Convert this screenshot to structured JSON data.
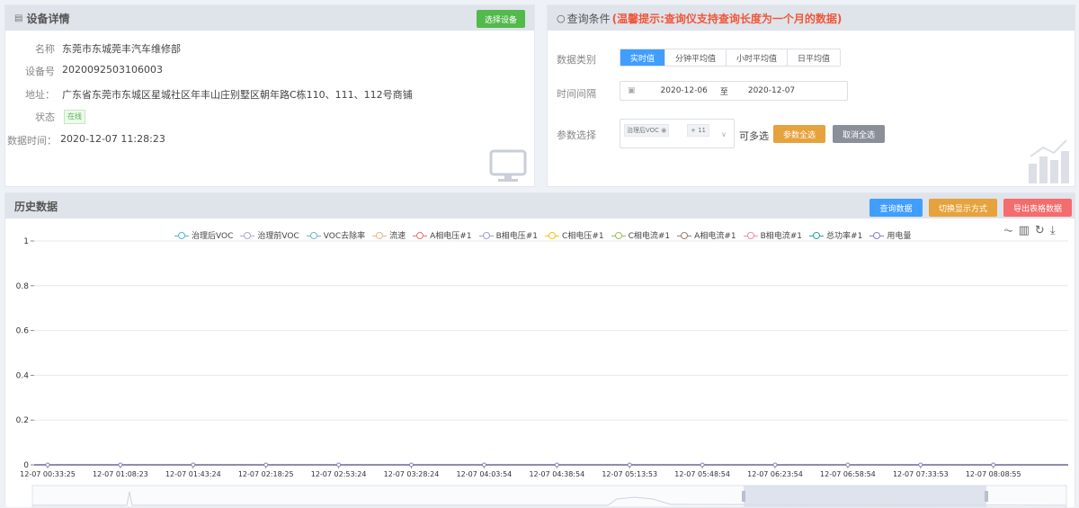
{
  "device": {
    "title": "设备详情",
    "select_button": "选择设备",
    "rows": [
      {
        "label": "名称",
        "value": "东莞市东城莞丰汽车维修部"
      },
      {
        "label": "设备号",
        "value": "2020092503106003"
      },
      {
        "label": "地址：",
        "value": "广东省东莞市东城区星城社区年丰山庄别墅区朝年路C栋110、111、112号商铺"
      },
      {
        "label": "状态",
        "value": "在线"
      },
      {
        "label": "数据时间：",
        "value": "2020-12-07 11:28:23"
      }
    ]
  },
  "query": {
    "title": "查询条件",
    "hint": "(温馨提示:查询仪支持查询长度为一个月的数据)",
    "type_label": "数据类别",
    "types": [
      "实时值",
      "分钟平均值",
      "小时平均值",
      "日平均值"
    ],
    "active_type": "实时值",
    "time_label": "时间间隔",
    "start_date": "2020-12-06",
    "range_sep": "至",
    "end_date": "2020-12-07",
    "param_label": "参数选择",
    "param_tag": "治理后VOC",
    "param_more": "+ 11",
    "multi_text": "可多选",
    "select_all": "参数全选",
    "cancel_all": "取消全选"
  },
  "history": {
    "title": "历史数据",
    "btn_query": "查询数据",
    "btn_switch": "切换显示方式",
    "btn_export": "导出表格数据"
  },
  "colors": {
    "green": "#52b94b",
    "blue": "#409eff",
    "orange": "#e6a23c",
    "gray": "#8a8f99",
    "red": "#f56c6c",
    "line": "#8e7cc3"
  },
  "chart_data": {
    "type": "line",
    "ylim": [
      0,
      1
    ],
    "yticks": [
      "0",
      "0.2",
      "0.4",
      "0.6",
      "0.8",
      "1"
    ],
    "categories": [
      "12-07 00:33:25",
      "12-07 01:08:23",
      "12-07 01:43:24",
      "12-07 02:18:25",
      "12-07 02:53:24",
      "12-07 03:28:24",
      "12-07 04:03:54",
      "12-07 04:38:54",
      "12-07 05:13:53",
      "12-07 05:48:54",
      "12-07 06:23:54",
      "12-07 06:58:54",
      "12-07 07:33:53",
      "12-07 08:08:55"
    ],
    "series": [
      {
        "name": "治理后VOC",
        "color": "#4fb6d6",
        "values": [
          0,
          0,
          0,
          0,
          0,
          0,
          0,
          0,
          0,
          0,
          0,
          0,
          0,
          0
        ]
      },
      {
        "name": "治理前VOC",
        "color": "#a8a8d8",
        "values": [
          0,
          0,
          0,
          0,
          0,
          0,
          0,
          0,
          0,
          0,
          0,
          0,
          0,
          0
        ]
      },
      {
        "name": "VOC去除率",
        "color": "#6fb3e0",
        "values": [
          0,
          0,
          0,
          0,
          0,
          0,
          0,
          0,
          0,
          0,
          0,
          0,
          0,
          0
        ]
      },
      {
        "name": "流速",
        "color": "#f4b183",
        "values": [
          0,
          0,
          0,
          0,
          0,
          0,
          0,
          0,
          0,
          0,
          0,
          0,
          0,
          0
        ]
      },
      {
        "name": "A相电压#1",
        "color": "#e57373",
        "values": [
          0,
          0,
          0,
          0,
          0,
          0,
          0,
          0,
          0,
          0,
          0,
          0,
          0,
          0
        ]
      },
      {
        "name": "B相电压#1",
        "color": "#9e9ed8",
        "values": [
          0,
          0,
          0,
          0,
          0,
          0,
          0,
          0,
          0,
          0,
          0,
          0,
          0,
          0
        ]
      },
      {
        "name": "C相电压#1",
        "color": "#f0c419",
        "values": [
          0,
          0,
          0,
          0,
          0,
          0,
          0,
          0,
          0,
          0,
          0,
          0,
          0,
          0
        ]
      },
      {
        "name": "C相电流#1",
        "color": "#9bbb59",
        "values": [
          0,
          0,
          0,
          0,
          0,
          0,
          0,
          0,
          0,
          0,
          0,
          0,
          0,
          0
        ]
      },
      {
        "name": "A相电流#1",
        "color": "#a07c6f",
        "values": [
          0,
          0,
          0,
          0,
          0,
          0,
          0,
          0,
          0,
          0,
          0,
          0,
          0,
          0
        ]
      },
      {
        "name": "B相电流#1",
        "color": "#e88bb0",
        "values": [
          0,
          0,
          0,
          0,
          0,
          0,
          0,
          0,
          0,
          0,
          0,
          0,
          0,
          0
        ]
      },
      {
        "name": "总功率#1",
        "color": "#2aa59b",
        "values": [
          0,
          0,
          0,
          0,
          0,
          0,
          0,
          0,
          0,
          0,
          0,
          0,
          0,
          0
        ]
      },
      {
        "name": "用电量",
        "color": "#8e7cc3",
        "values": [
          0,
          0,
          0,
          0,
          0,
          0,
          0,
          0,
          0,
          0,
          0,
          0,
          0,
          0
        ]
      }
    ],
    "grid": true,
    "legend_position": "top"
  }
}
